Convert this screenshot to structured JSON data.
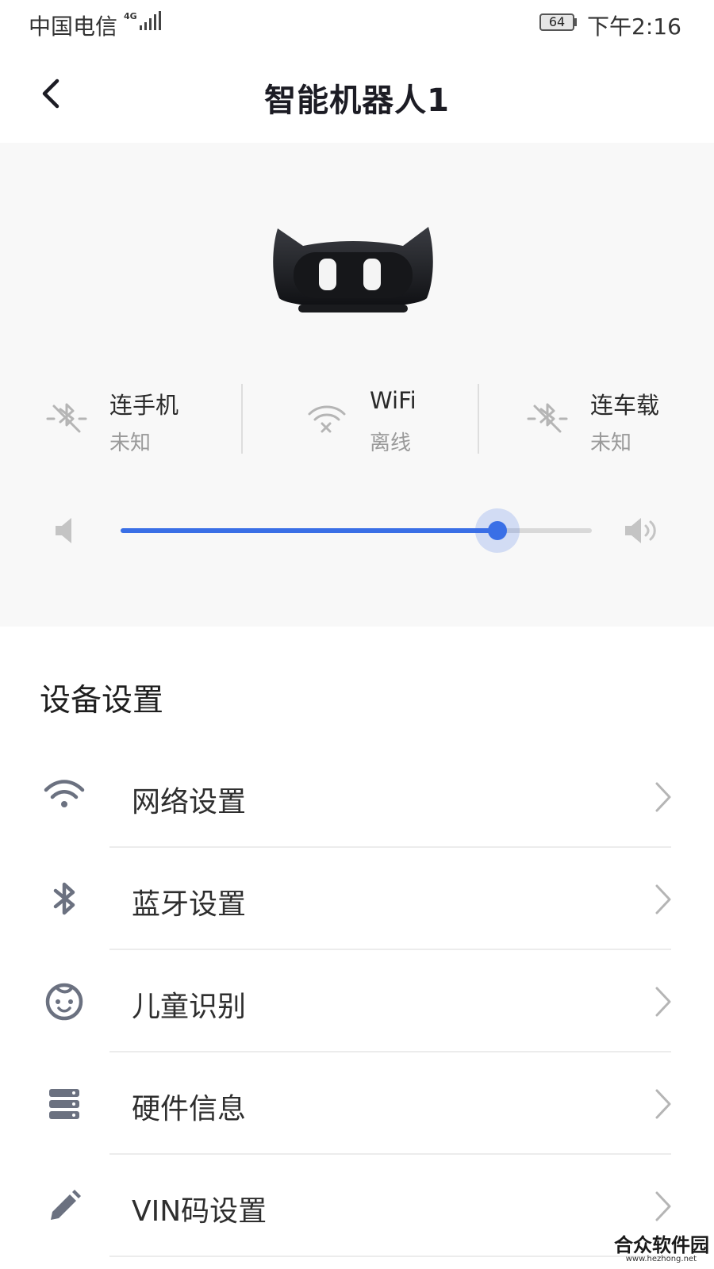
{
  "status_bar": {
    "carrier": "中国电信",
    "network": "4G",
    "battery": "64",
    "time": "下午2:16"
  },
  "header": {
    "title": "智能机器人1",
    "back_icon": "chevron-left-icon"
  },
  "connections": [
    {
      "label": "连手机",
      "status": "未知",
      "icon": "bluetooth-disabled-icon"
    },
    {
      "label": "WiFi",
      "status": "离线",
      "icon": "wifi-off-icon"
    },
    {
      "label": "连车载",
      "status": "未知",
      "icon": "bluetooth-disabled-icon"
    }
  ],
  "volume": {
    "level": 0.8,
    "low_icon": "volume-low-icon",
    "high_icon": "volume-high-icon",
    "accent": "#3a6fe6"
  },
  "settings": {
    "title": "设备设置",
    "items": [
      {
        "label": "网络设置",
        "icon": "wifi-icon"
      },
      {
        "label": "蓝牙设置",
        "icon": "bluetooth-icon"
      },
      {
        "label": "儿童识别",
        "icon": "child-face-icon"
      },
      {
        "label": "硬件信息",
        "icon": "server-icon"
      },
      {
        "label": "VIN码设置",
        "icon": "pencil-icon"
      }
    ]
  },
  "watermark": {
    "name": "合众软件园",
    "url": "www.hezhong.net"
  }
}
